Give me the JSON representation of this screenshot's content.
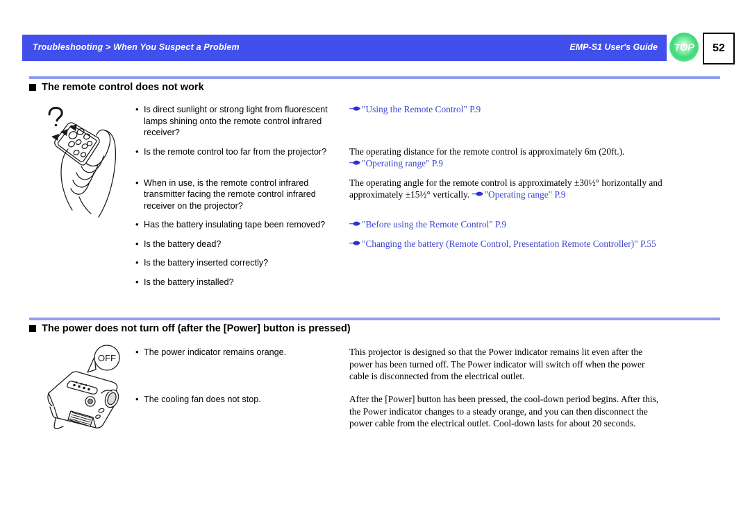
{
  "header": {
    "breadcrumb": "Troubleshooting > When You Suspect a Problem",
    "guide_title": "EMP-S1 User's Guide",
    "top_badge_label": "TOP",
    "page_number": "52",
    "bar_color": "#4150ec",
    "badge_color": "#3ddb77"
  },
  "sections": [
    {
      "heading": "The remote control does not work",
      "illustration": "hand-holding-remote-illustration",
      "checks": [
        {
          "text": "Is direct sunlight or strong light from fluorescent lamps shining onto the remote control infrared receiver?"
        },
        {
          "text": "Is the remote control too far from the projector?"
        },
        {
          "text": "When in use, is the remote control infrared transmitter facing the remote control infrared receiver on the projector?"
        },
        {
          "text": "Has the battery insulating tape been removed?"
        },
        {
          "text": "Is the battery dead?"
        },
        {
          "text": "Is the battery inserted correctly?"
        },
        {
          "text": "Is the battery installed?"
        }
      ],
      "remedies": [
        {
          "plain": "",
          "link": "\"Using the Remote Control\" P.9",
          "trailing": ""
        },
        {
          "plain": "The operating distance for the remote control is approximately 6m (20ft.).",
          "link": "\"Operating range\" P.9",
          "trailing": ""
        },
        {
          "plain": "The operating angle for the remote control is approximately ±30½° horizontally and approximately ±15½° vertically.",
          "link": "\"Operating range\" P.9",
          "trailing": ""
        },
        {
          "plain": "",
          "link": "\"Before using the Remote Control\" P.9",
          "trailing": ""
        },
        {
          "plain": "",
          "link": "\"Changing the battery (Remote Control, Presentation Remote Controller)\" P.55",
          "trailing": ""
        }
      ]
    },
    {
      "heading": "The power does not turn off (after the [Power] button is pressed)",
      "illustration": "projector-off-illustration",
      "illustration_callout": "OFF",
      "checks": [
        {
          "text": "The power indicator remains orange."
        },
        {
          "text": "The cooling fan does not stop."
        }
      ],
      "remedies": [
        {
          "plain": "This projector is designed so that the Power indicator remains lit even after the power has been turned off. The Power indicator will switch off when the power cable is disconnected from the electrical outlet.",
          "link": "",
          "trailing": ""
        },
        {
          "plain": "After the [Power] button has been pressed, the cool-down period begins. After this, the Power indicator changes to a steady orange, and you can then disconnect the power cable from the electrical outlet. Cool-down lasts for about 20 seconds.",
          "link": "",
          "trailing": ""
        }
      ]
    }
  ]
}
